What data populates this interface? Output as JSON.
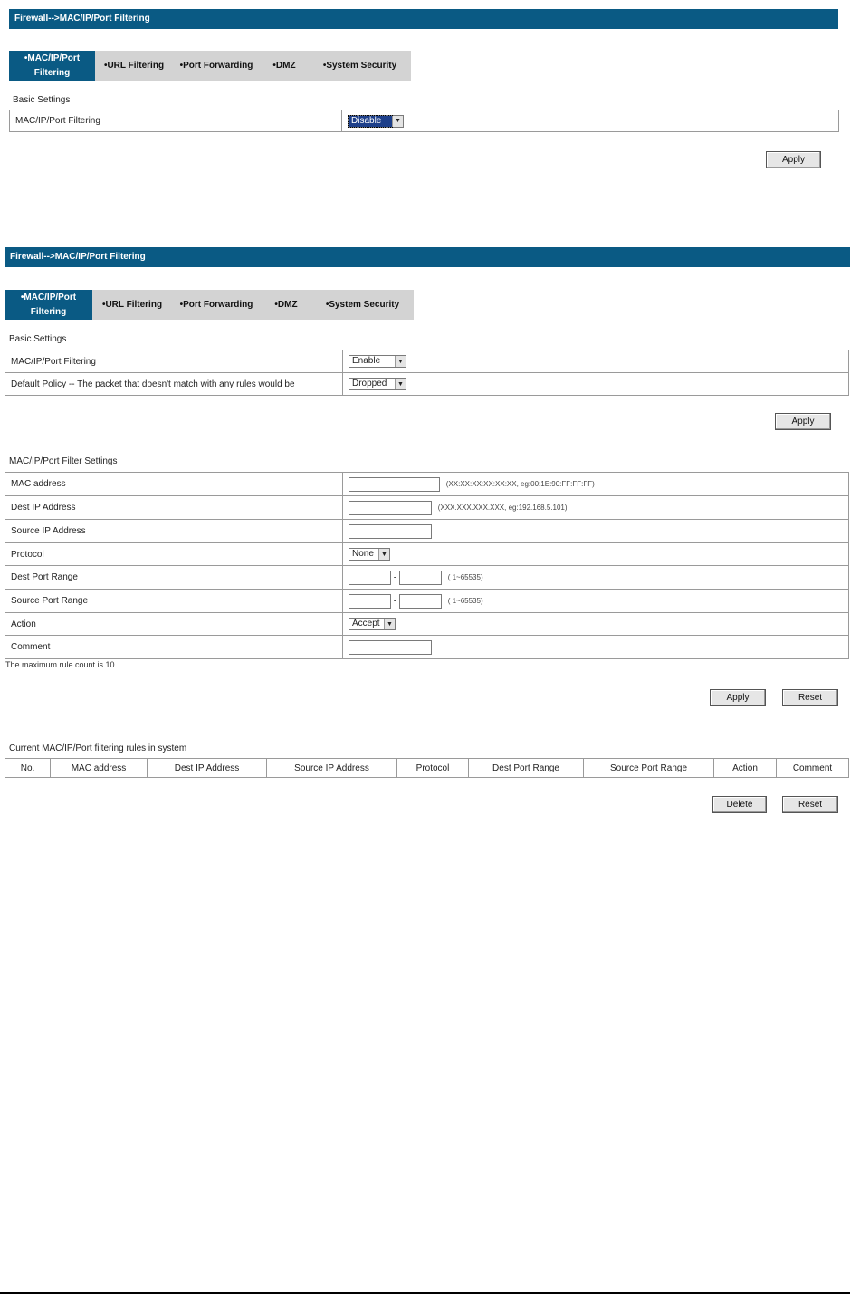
{
  "panel1": {
    "title": "Firewall-->MAC/IP/Port Filtering",
    "tabs": [
      {
        "label": "•MAC/IP/Port Filtering",
        "active": true
      },
      {
        "label": "•URL Filtering"
      },
      {
        "label": "•Port Forwarding"
      },
      {
        "label": "•DMZ"
      },
      {
        "label": "•System Security"
      }
    ],
    "basic_settings_title": "Basic Settings",
    "filter_label": "MAC/IP/Port Filtering",
    "filter_value": "Disable",
    "apply_label": "Apply"
  },
  "panel2": {
    "title": "Firewall-->MAC/IP/Port Filtering",
    "tabs": [
      {
        "label": "•MAC/IP/Port Filtering",
        "active": true
      },
      {
        "label": "•URL Filtering"
      },
      {
        "label": "•Port Forwarding"
      },
      {
        "label": "•DMZ"
      },
      {
        "label": "•System Security"
      }
    ],
    "basic_settings_title": "Basic Settings",
    "filter_label": "MAC/IP/Port Filtering",
    "filter_value": "Enable",
    "policy_label": "Default Policy -- The packet that doesn't match with any rules would be",
    "policy_value": "Dropped",
    "apply_label": "Apply",
    "filter_settings": {
      "title": "MAC/IP/Port Filter Settings",
      "mac_label": "MAC address",
      "mac_hint": "(XX:XX:XX:XX:XX:XX, eg:00:1E:90:FF:FF:FF)",
      "dest_ip_label": "Dest IP Address",
      "dest_ip_hint": "(XXX.XXX.XXX.XXX, eg:192.168.5.101)",
      "src_ip_label": "Source IP Address",
      "protocol_label": "Protocol",
      "protocol_value": "None",
      "dest_port_label": "Dest Port Range",
      "src_port_label": "Source Port Range",
      "port_dash": "-",
      "port_hint": "( 1~65535)",
      "action_label": "Action",
      "action_value": "Accept",
      "comment_label": "Comment",
      "max_rule_note": "The maximum rule count is 10.",
      "apply_label": "Apply",
      "reset_label": "Reset"
    },
    "rules": {
      "title": "Current MAC/IP/Port filtering rules in system",
      "columns": [
        "No.",
        "MAC address",
        "Dest IP Address",
        "Source IP Address",
        "Protocol",
        "Dest Port Range",
        "Source Port Range",
        "Action",
        "Comment"
      ],
      "delete_label": "Delete",
      "reset_label": "Reset"
    }
  }
}
